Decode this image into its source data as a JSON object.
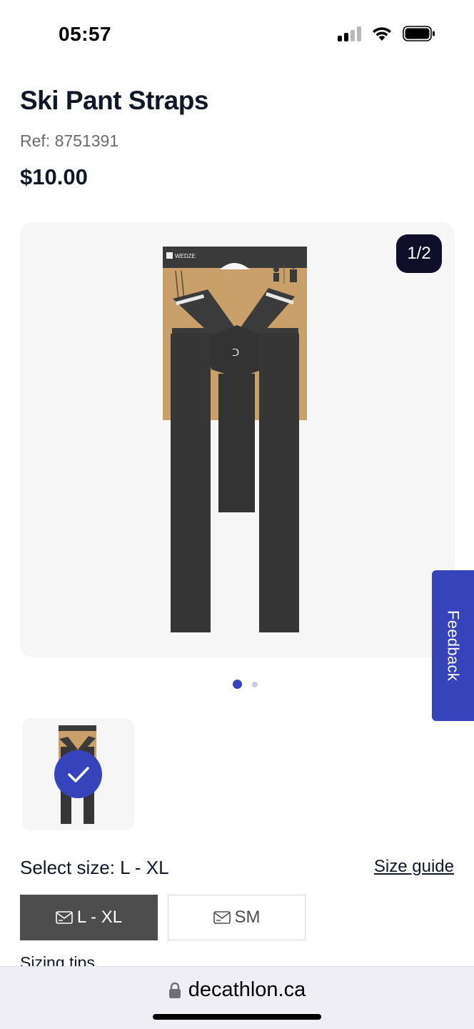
{
  "status_bar": {
    "time": "05:57",
    "icons": [
      "cellular-signal-icon",
      "wifi-icon",
      "battery-icon"
    ]
  },
  "product": {
    "title": "Ski Pant Straps",
    "ref": "Ref: 8751391",
    "price": "$10.00"
  },
  "gallery": {
    "counter": "1/2",
    "package_brand": "WEDZE",
    "image_description_icon": "suspenders-product-image",
    "dots_total": 2,
    "dots_active_index": 0
  },
  "feedback": {
    "label": "Feedback"
  },
  "size": {
    "select_label": "Select size: L - XL",
    "guide_label": "Size guide",
    "options": [
      {
        "label": "L - XL",
        "selected": true
      },
      {
        "label": "SM",
        "selected": false
      }
    ],
    "tips_label": "Sizing tips"
  },
  "browser": {
    "url": "decathlon.ca"
  },
  "colors": {
    "brand_blue": "#3643ba",
    "counter_bg": "#0f0f29",
    "selected_size_bg": "#4d4d4d"
  }
}
